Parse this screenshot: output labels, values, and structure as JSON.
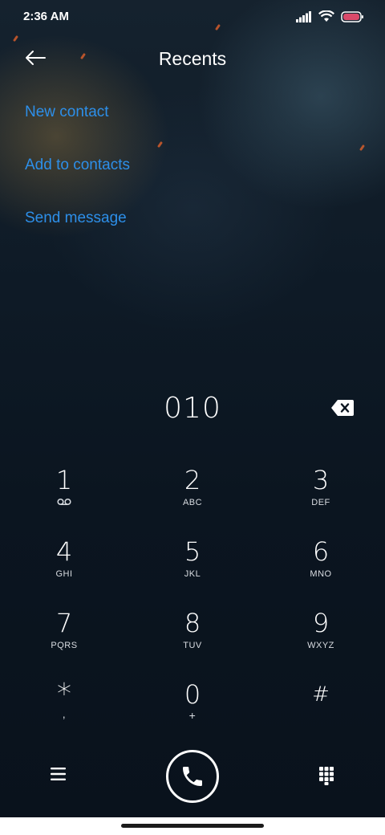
{
  "status_bar": {
    "time": "2:36 AM"
  },
  "header": {
    "title": "Recents",
    "back_icon": "arrow-left-icon"
  },
  "actions": [
    {
      "label": "New contact"
    },
    {
      "label": "Add to contacts"
    },
    {
      "label": "Send message"
    }
  ],
  "accent_color": "#2d8fe9",
  "dialer": {
    "number": "010",
    "backspace_icon": "backspace-icon"
  },
  "keypad": [
    {
      "digit": "1",
      "letters": ""
    },
    {
      "digit": "2",
      "letters": "ABC"
    },
    {
      "digit": "3",
      "letters": "DEF"
    },
    {
      "digit": "4",
      "letters": "GHI"
    },
    {
      "digit": "5",
      "letters": "JKL"
    },
    {
      "digit": "6",
      "letters": "MNO"
    },
    {
      "digit": "7",
      "letters": "PQRS"
    },
    {
      "digit": "8",
      "letters": "TUV"
    },
    {
      "digit": "9",
      "letters": "WXYZ"
    },
    {
      "digit": "*",
      "letters": ","
    },
    {
      "digit": "0",
      "letters": "+"
    },
    {
      "digit": "#",
      "letters": ""
    }
  ],
  "bottom_bar": {
    "menu_icon": "menu-icon",
    "call_icon": "phone-icon",
    "dialpad_icon": "dialpad-icon"
  }
}
